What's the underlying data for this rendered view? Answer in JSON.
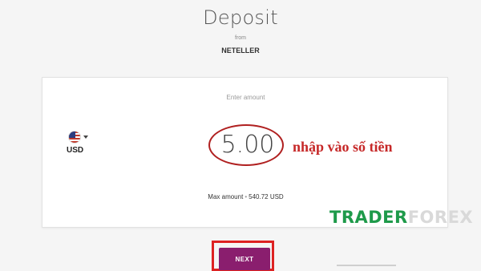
{
  "header": {
    "title": "Deposit",
    "from_label": "from",
    "provider": "NETELLER"
  },
  "form": {
    "enter_label": "Enter amount",
    "currency": {
      "code": "USD",
      "flag_icon": "us-flag-icon"
    },
    "amount_value": "5.00",
    "max_amount": {
      "label": "Max amount",
      "value": "540.72 USD"
    }
  },
  "overlay": {
    "annotation": "nhập vào số tiền",
    "watermark_a": "TRADER",
    "watermark_b": "FOREX",
    "annotation_color": "#c62828",
    "highlight_color": "#dd2222"
  },
  "actions": {
    "next_label": "NEXT",
    "next_color": "#8a1e6e"
  }
}
